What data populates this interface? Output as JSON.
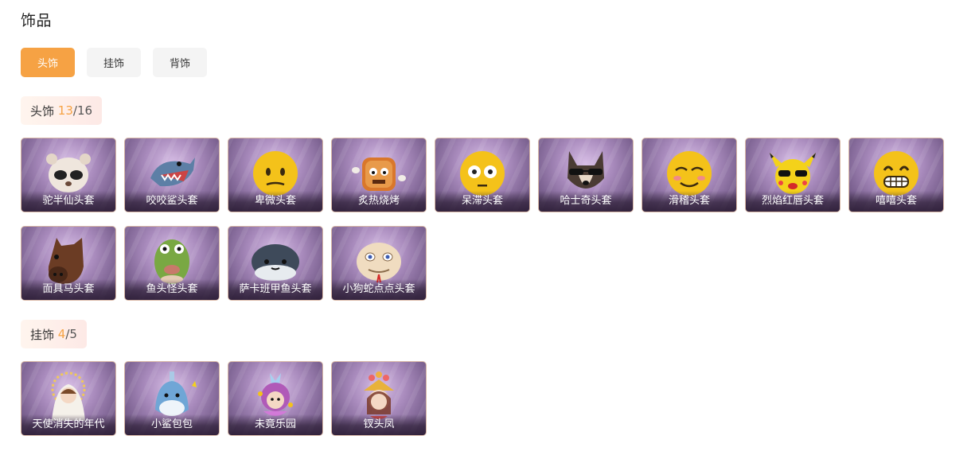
{
  "page_title": "饰品",
  "tabs": [
    {
      "label": "头饰",
      "active": true
    },
    {
      "label": "挂饰",
      "active": false
    },
    {
      "label": "背饰",
      "active": false
    }
  ],
  "sections": [
    {
      "label": "头饰",
      "owned": "13",
      "total": "16",
      "items": [
        {
          "name": "驼半仙头套",
          "icon": "raccoon-mask-icon"
        },
        {
          "name": "咬咬鲨头套",
          "icon": "shark-mask-icon"
        },
        {
          "name": "卑微头套",
          "icon": "humble-emoji-mask-icon"
        },
        {
          "name": "炙热烧烤",
          "icon": "bbq-mask-icon"
        },
        {
          "name": "呆滞头套",
          "icon": "dazed-emoji-mask-icon"
        },
        {
          "name": "哈士奇头套",
          "icon": "husky-mask-icon"
        },
        {
          "name": "滑稽头套",
          "icon": "funny-emoji-mask-icon"
        },
        {
          "name": "烈焰红唇头套",
          "icon": "red-lips-pikachu-mask-icon"
        },
        {
          "name": "嘻嘻头套",
          "icon": "grin-emoji-mask-icon"
        },
        {
          "name": "面具马头套",
          "icon": "horse-mask-icon"
        },
        {
          "name": "鱼头怪头套",
          "icon": "fish-head-mask-icon"
        },
        {
          "name": "萨卡班甲鱼头套",
          "icon": "sacabambaspis-mask-icon"
        },
        {
          "name": "小狗蛇点点头套",
          "icon": "dog-snake-mask-icon"
        }
      ]
    },
    {
      "label": "挂饰",
      "owned": "4",
      "total": "5",
      "items": [
        {
          "name": "天使消失的年代",
          "icon": "angel-pendant-icon"
        },
        {
          "name": "小鲨包包",
          "icon": "shark-bag-icon"
        },
        {
          "name": "未竟乐园",
          "icon": "paradise-doll-icon"
        },
        {
          "name": "钗头凤",
          "icon": "phoenix-hairpin-doll-icon"
        }
      ]
    }
  ],
  "colors": {
    "accent": "#f6a244",
    "card_bg": "#8a6f9e"
  }
}
